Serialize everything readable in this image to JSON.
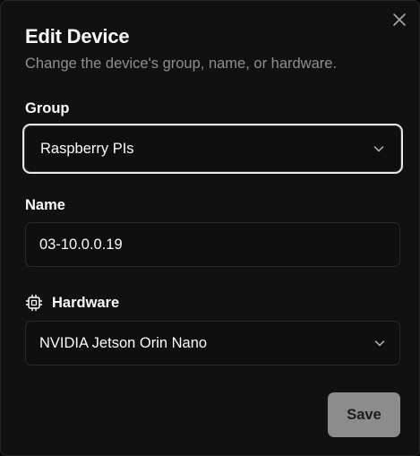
{
  "dialog": {
    "title": "Edit Device",
    "subtitle": "Change the device's group, name, or hardware.",
    "close_icon": "close-icon"
  },
  "group": {
    "label": "Group",
    "value": "Raspberry PIs",
    "icon": "chevron-down-icon"
  },
  "name": {
    "label": "Name",
    "value": "03-10.0.0.19"
  },
  "hardware": {
    "label": "Hardware",
    "label_icon": "chip-icon",
    "value": "NVIDIA Jetson Orin Nano",
    "icon": "chevron-down-icon"
  },
  "actions": {
    "save_label": "Save"
  },
  "colors": {
    "background": "#111111",
    "text": "#fafafa",
    "muted": "#8f8f8f",
    "save_button": "#8c8c8c"
  }
}
